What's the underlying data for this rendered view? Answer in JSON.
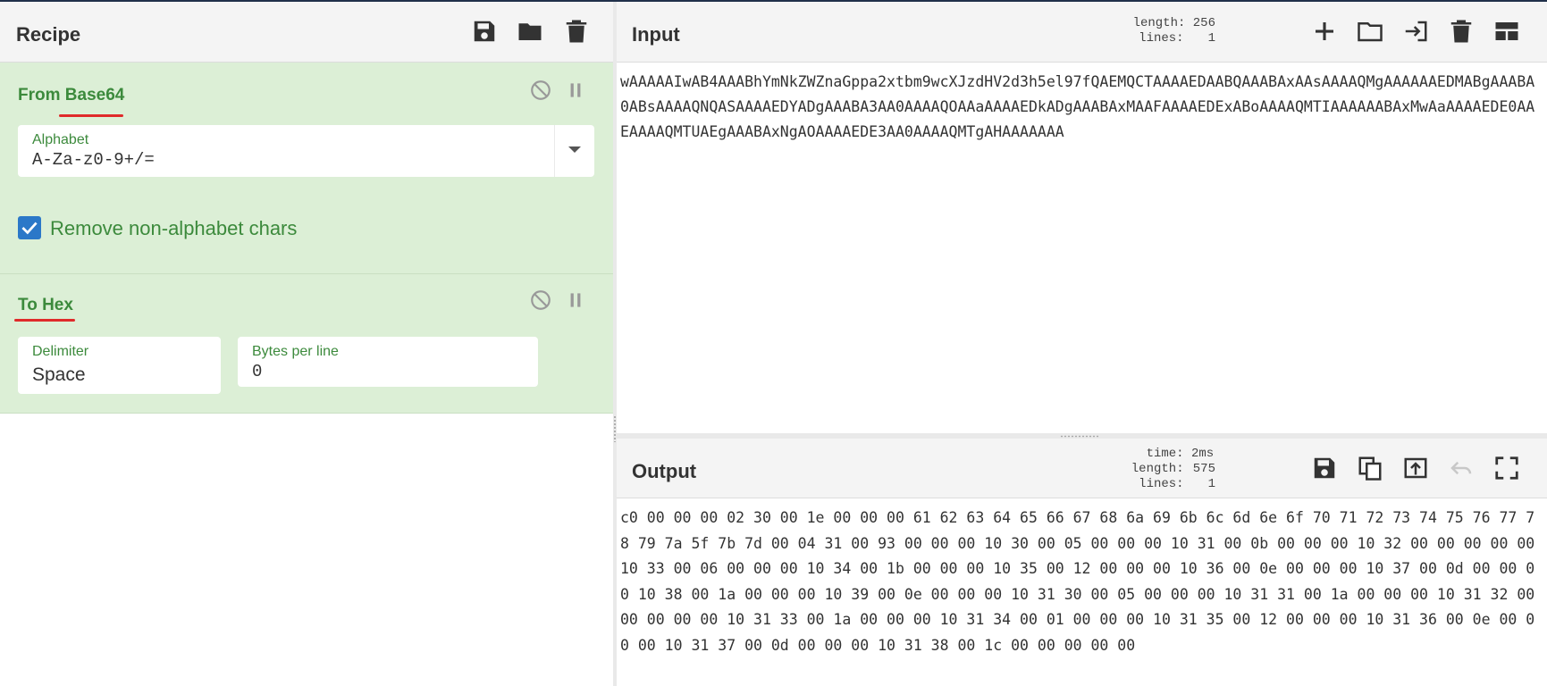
{
  "recipe": {
    "title": "Recipe",
    "header_icons": [
      "save-icon",
      "folder-open-icon",
      "trash-icon"
    ],
    "operations": [
      {
        "name": "From Base64",
        "controls": [
          "disable-icon",
          "pause-icon"
        ],
        "alphabet": {
          "label": "Alphabet",
          "value": "A-Za-z0-9+/="
        },
        "remove_non_alphabet": {
          "label": "Remove non-alphabet chars",
          "checked": true
        }
      },
      {
        "name": "To Hex",
        "controls": [
          "disable-icon",
          "pause-icon"
        ],
        "delimiter": {
          "label": "Delimiter",
          "value": "Space"
        },
        "bytes_per_line": {
          "label": "Bytes per line",
          "value": "0"
        }
      }
    ]
  },
  "input": {
    "title": "Input",
    "stats": {
      "length_label": "length:",
      "length": "256",
      "lines_label": "lines:",
      "lines": "1"
    },
    "toolbar_icons": [
      "plus-icon",
      "open-folder-icon",
      "import-icon",
      "trash-icon",
      "layout-icon"
    ],
    "text": "wAAAAAIwAB4AAABhYmNkZWZnaGppa2xtbm9wcXJzdHV2d3h5el97fQAEMQCTAAAAEDAABQAAABAxAAsAAAAQMgAAAAAAEDMABgAAABA0ABsAAAAQNQASAAAAEDYADgAAABA3AA0AAAAQOAAaAAAAEDkADgAAABAxMAAFAAAAEDExABoAAAAQMTIAAAAAABAxMwAaAAAAEDE0AAEAAAAQMTUAEgAAABAxNgAOAAAAEDE3AA0AAAAQMTgAHAAAAAAA"
  },
  "output": {
    "title": "Output",
    "stats": {
      "time_label": "time:",
      "time": "2ms",
      "length_label": "length:",
      "length": "575",
      "lines_label": "lines:",
      "lines": "1"
    },
    "toolbar_icons": [
      "save-icon",
      "copy-icon",
      "replace-input-icon",
      "undo-icon",
      "fullscreen-icon"
    ],
    "text": "c0 00 00 00 02 30 00 1e 00 00 00 61 62 63 64 65 66 67 68 6a 69 6b 6c 6d 6e 6f 70 71 72 73 74 75 76 77 78 79 7a 5f 7b 7d 00 04 31 00 93 00 00 00 10 30 00 05 00 00 00 10 31 00 0b 00 00 00 10 32 00 00 00 00 00 10 33 00 06 00 00 00 10 34 00 1b 00 00 00 10 35 00 12 00 00 00 10 36 00 0e 00 00 00 10 37 00 0d 00 00 00 10 38 00 1a 00 00 00 10 39 00 0e 00 00 00 10 31 30 00 05 00 00 00 10 31 31 00 1a 00 00 00 10 31 32 00 00 00 00 00 10 31 33 00 1a 00 00 00 10 31 34 00 01 00 00 00 10 31 35 00 12 00 00 00 10 31 36 00 0e 00 00 00 10 31 37 00 0d 00 00 00 10 31 38 00 1c 00 00 00 00 00"
  }
}
